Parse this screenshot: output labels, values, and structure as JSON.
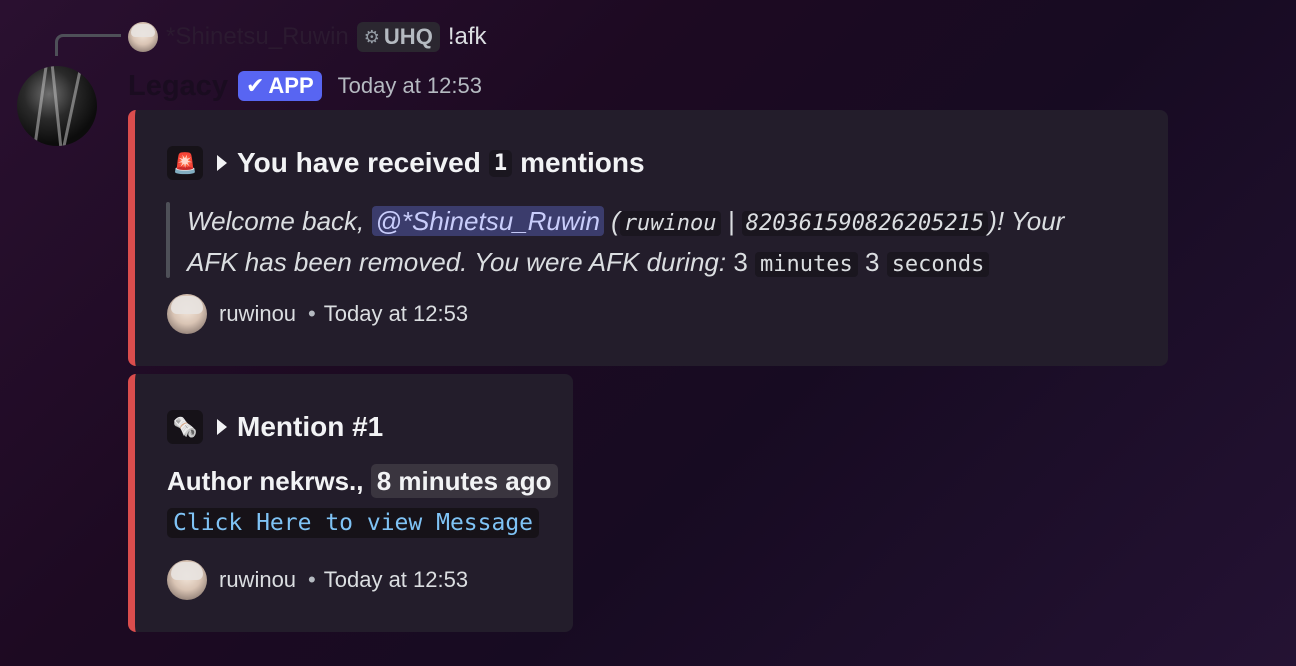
{
  "reply": {
    "author": "*Shinetsu_Ruwin",
    "tag": "UHQ",
    "tag_icon": "gear-icon",
    "text": "!afk"
  },
  "message": {
    "author": "Legacy",
    "badge": "APP",
    "timestamp": "Today at 12:53"
  },
  "embed1": {
    "emoji": "🚨",
    "title_prefix": "You have received",
    "count": "1",
    "title_suffix": "mentions",
    "quote": {
      "welcome": "Welcome back,",
      "mention": "@*Shinetsu_Ruwin",
      "open_paren": "(",
      "username": "ruwinou",
      "sep": "|",
      "user_id": "820361590826205215",
      "close": ")! Your",
      "line2": "AFK has been removed. You were AFK during:",
      "minutes_value": "3",
      "minutes_label": "minutes",
      "seconds_value": "3",
      "seconds_label": "seconds"
    },
    "footer": {
      "name": "ruwinou",
      "dot": "•",
      "time": "Today at 12:53"
    },
    "accent": "#da4d4d"
  },
  "embed2": {
    "emoji": "🗞️",
    "title": "Mention #1",
    "author_prefix": "Author nekrws.,",
    "time_ago": "8 minutes ago",
    "link": "Click Here to view Message",
    "footer": {
      "name": "ruwinou",
      "dot": "•",
      "time": "Today at 12:53"
    },
    "accent": "#da4d4d"
  }
}
